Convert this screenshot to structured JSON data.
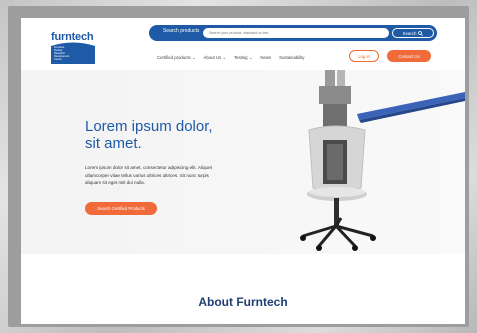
{
  "header": {
    "logo_text": "furntech",
    "logo_lines": [
      "Furniture",
      "Testing",
      "Research",
      "Development",
      "Centre"
    ],
    "search": {
      "label": "Search products",
      "placeholder": "Search your product, standard or test",
      "button_label": "Search"
    },
    "nav": [
      "Certified products ⌄",
      "About Us ⌄",
      "Testing ⌄",
      "News",
      "Sustainability"
    ],
    "login_label": "Log in",
    "contact_label": "Contact Us"
  },
  "hero": {
    "title": "Lorem ipsum dolor, sit amet.",
    "body": "Lorem ipsum dolor sit amet, consectetur adipiscing elit. Aliquet ullamcorper vitae tellus varius ultrices ultrices. Sit nunc turpis aliquam sit eget nisl dui nulla.",
    "cta_label": "Search Certified Products"
  },
  "about": {
    "title": "About Furntech"
  },
  "colors": {
    "brand_blue": "#1f5aa6",
    "accent_orange": "#f06a3a",
    "heading_navy": "#1f3e72"
  }
}
